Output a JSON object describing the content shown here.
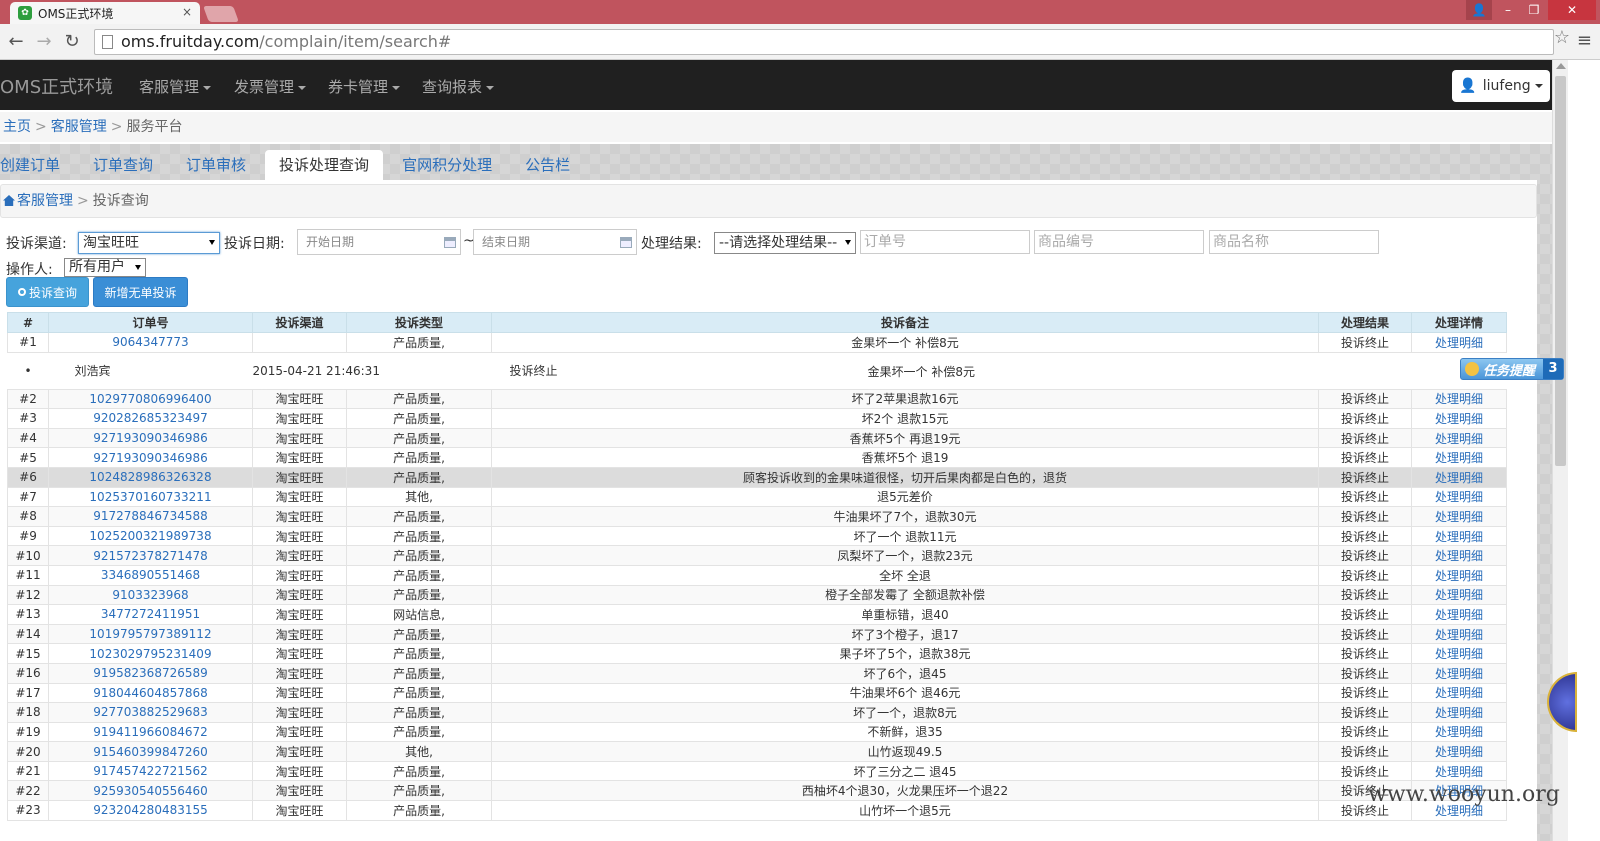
{
  "browser": {
    "tab_title": "OMS正式环境",
    "tab_close": "×",
    "url_host": "oms.fruitday.com",
    "url_path": "/complain/item/search#"
  },
  "navbar": {
    "brand": "OMS正式环境",
    "menus": [
      "客服管理",
      "发票管理",
      "券卡管理",
      "查询报表"
    ],
    "user": "liufeng"
  },
  "breadcrumb": [
    "主页",
    "客服管理",
    "服务平台"
  ],
  "tabs": [
    "创建订单",
    "订单查询",
    "订单审核",
    "投诉处理查询",
    "官网积分处理",
    "公告栏"
  ],
  "active_tab": "投诉处理查询",
  "sub_breadcrumb": [
    "客服管理",
    "投诉查询"
  ],
  "filters": {
    "channel_label": "投诉渠道:",
    "channel_value": "淘宝旺旺",
    "date_label": "投诉日期:",
    "start_placeholder": "开始日期",
    "tilde": "~",
    "end_placeholder": "结束日期",
    "result_label": "处理结果:",
    "result_value": "--请选择处理结果--",
    "order_placeholder": "订单号",
    "product_code_placeholder": "商品编号",
    "product_name_placeholder": "商品名称",
    "operator_label": "操作人:",
    "operator_value": "所有用户",
    "search_btn": "投诉查询",
    "add_btn": "新增无单投诉"
  },
  "table": {
    "headers": [
      "#",
      "订单号",
      "投诉渠道",
      "投诉类型",
      "投诉备注",
      "处理结果",
      "处理详情"
    ],
    "detail_row": {
      "bullet": "•",
      "user": "刘浩宾",
      "time": "2015-04-21 21:46:31",
      "status": "投诉终止",
      "note": "金果坏一个 补偿8元"
    },
    "rows": [
      [
        "#1",
        "9064347773",
        "",
        "产品质量,",
        "金果坏一个 补偿8元",
        "投诉终止",
        "处理明细"
      ],
      [
        "#2",
        "1029770806996400",
        "淘宝旺旺",
        "产品质量,",
        "坏了2苹果退款16元",
        "投诉终止",
        "处理明细"
      ],
      [
        "#3",
        "920282685323497",
        "淘宝旺旺",
        "产品质量,",
        "坏2个 退款15元",
        "投诉终止",
        "处理明细"
      ],
      [
        "#4",
        "927193090346986",
        "淘宝旺旺",
        "产品质量,",
        "香蕉坏5个 再退19元",
        "投诉终止",
        "处理明细"
      ],
      [
        "#5",
        "927193090346986",
        "淘宝旺旺",
        "产品质量,",
        "香蕉坏5个 退19",
        "投诉终止",
        "处理明细"
      ],
      [
        "#6",
        "1024828986326328",
        "淘宝旺旺",
        "产品质量,",
        "顾客投诉收到的金果味道很怪，切开后果肉都是白色的，退货",
        "投诉终止",
        "处理明细"
      ],
      [
        "#7",
        "1025370160733211",
        "淘宝旺旺",
        "其他,",
        "退5元差价",
        "投诉终止",
        "处理明细"
      ],
      [
        "#8",
        "917278846734588",
        "淘宝旺旺",
        "产品质量,",
        "牛油果坏了7个，退款30元",
        "投诉终止",
        "处理明细"
      ],
      [
        "#9",
        "1025200321989738",
        "淘宝旺旺",
        "产品质量,",
        "坏了一个 退款11元",
        "投诉终止",
        "处理明细"
      ],
      [
        "#10",
        "921572378271478",
        "淘宝旺旺",
        "产品质量,",
        "凤梨坏了一个，退款23元",
        "投诉终止",
        "处理明细"
      ],
      [
        "#11",
        "3346890551468",
        "淘宝旺旺",
        "产品质量,",
        "全坏 全退",
        "投诉终止",
        "处理明细"
      ],
      [
        "#12",
        "9103323968",
        "淘宝旺旺",
        "产品质量,",
        "橙子全部发霉了 全额退款补偿",
        "投诉终止",
        "处理明细"
      ],
      [
        "#13",
        "3477272411951",
        "淘宝旺旺",
        "网站信息,",
        "单重标错，退40",
        "投诉终止",
        "处理明细"
      ],
      [
        "#14",
        "1019795797389112",
        "淘宝旺旺",
        "产品质量,",
        "坏了3个橙子，退17",
        "投诉终止",
        "处理明细"
      ],
      [
        "#15",
        "1023029795231409",
        "淘宝旺旺",
        "产品质量,",
        "果子坏了5个，退款38元",
        "投诉终止",
        "处理明细"
      ],
      [
        "#16",
        "919582368726589",
        "淘宝旺旺",
        "产品质量,",
        "坏了6个，退45",
        "投诉终止",
        "处理明细"
      ],
      [
        "#17",
        "918044604857868",
        "淘宝旺旺",
        "产品质量,",
        "牛油果坏6个 退46元",
        "投诉终止",
        "处理明细"
      ],
      [
        "#18",
        "927703882529683",
        "淘宝旺旺",
        "产品质量,",
        "坏了一个，退款8元",
        "投诉终止",
        "处理明细"
      ],
      [
        "#19",
        "919411966084672",
        "淘宝旺旺",
        "产品质量,",
        "不新鲜，退35",
        "投诉终止",
        "处理明细"
      ],
      [
        "#20",
        "915460399847260",
        "淘宝旺旺",
        "其他,",
        "山竹返现49.5",
        "投诉终止",
        "处理明细"
      ],
      [
        "#21",
        "917457422721562",
        "淘宝旺旺",
        "产品质量,",
        "坏了三分之二 退45",
        "投诉终止",
        "处理明细"
      ],
      [
        "#22",
        "925930540556460",
        "淘宝旺旺",
        "产品质量,",
        "西柚坏4个退30，火龙果压坏一个退22",
        "投诉终止",
        "处理明细"
      ],
      [
        "#23",
        "923204280483155",
        "淘宝旺旺",
        "产品质量,",
        "山竹坏一个退5元",
        "投诉终止",
        "处理明细"
      ]
    ],
    "highlighted_row": "#6"
  },
  "task_reminder": {
    "label": "任务提醒",
    "count": "3"
  },
  "watermark": "www.wooyun.org",
  "icons": [
    "favicon-icon",
    "back-icon",
    "forward-icon",
    "reload-icon",
    "page-icon",
    "star-icon",
    "menu-icon",
    "user-icon",
    "home-icon",
    "calendar-icon",
    "search-icon"
  ]
}
